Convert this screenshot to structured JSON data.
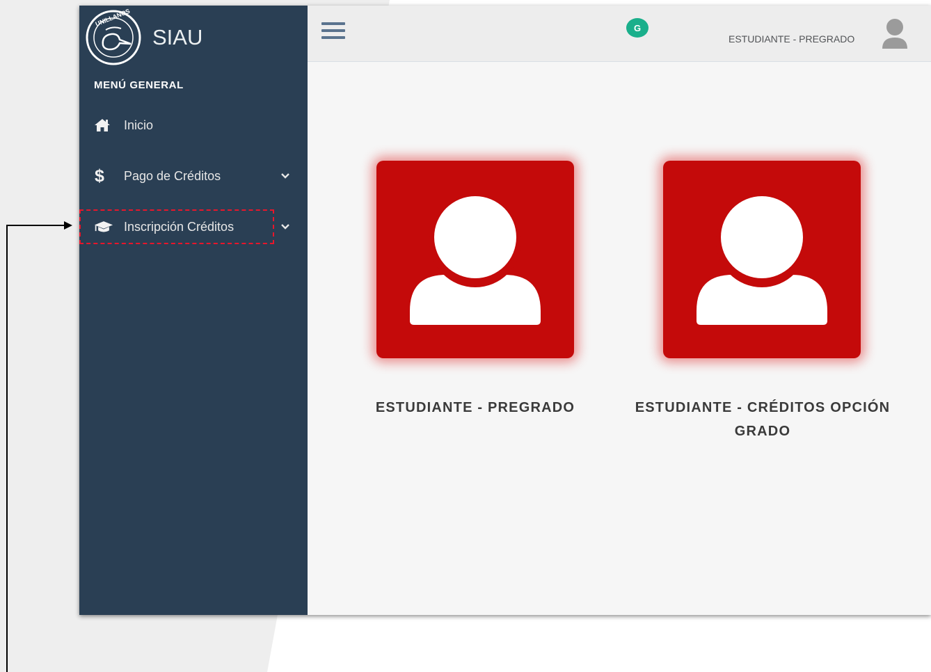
{
  "sidebar": {
    "brand": {
      "title": "SIAU",
      "logo_text": "UNILLANOS"
    },
    "menu_heading": "MENÚ GENERAL",
    "items": [
      {
        "label": "Inicio",
        "icon": "home-icon"
      },
      {
        "label": "Pago de Créditos",
        "icon": "dollar-icon",
        "expandable": true
      },
      {
        "label": "Inscripción Créditos",
        "icon": "graduation-cap-icon",
        "expandable": true
      }
    ]
  },
  "topbar": {
    "menu_icon": "hamburger-icon",
    "badge": "G",
    "user_role": "ESTUDIANTE - PREGRADO",
    "avatar_icon": "user-avatar-icon"
  },
  "profiles": [
    {
      "label": "ESTUDIANTE - PREGRADO",
      "icon": "user-icon"
    },
    {
      "label": "ESTUDIANTE - CRÉDITOS OPCIÓN GRADO",
      "icon": "user-icon"
    }
  ],
  "colors": {
    "sidebar": "#2a3f54",
    "card": "#c40a0a",
    "highlight": "#e8162b",
    "badge": "#1aaf8b"
  }
}
